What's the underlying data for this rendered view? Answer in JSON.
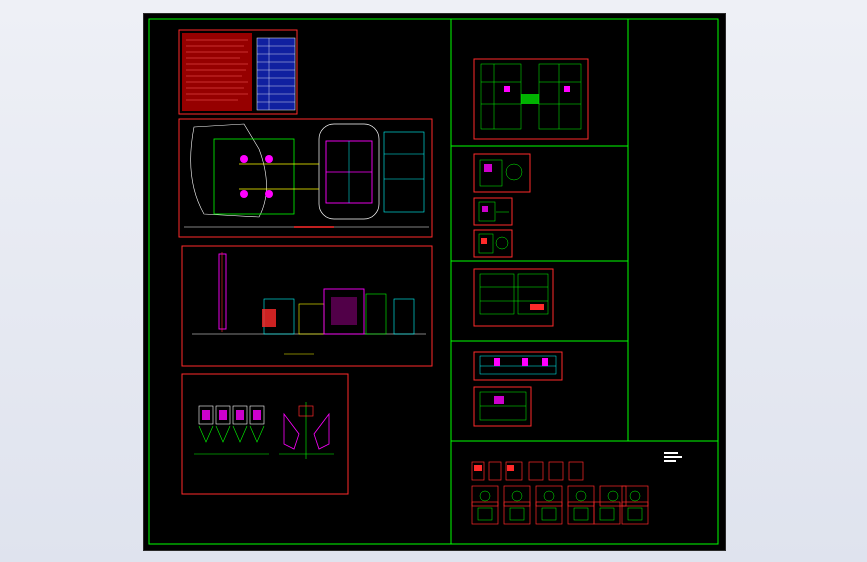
{
  "app": {
    "title": "",
    "viewport_background": "#000000",
    "outer_background": "#e6e9f1"
  },
  "colors": {
    "frame_green": "#00ff00",
    "sheet_border": "#ff2a2a",
    "cyan": "#00ffff",
    "magenta": "#ff00ff",
    "yellow": "#ffff00",
    "white": "#ffffff",
    "red_fill": "#d40000"
  },
  "drawing": {
    "sheets": [
      {
        "id": "notes-sheet",
        "kind": "notes-and-table"
      },
      {
        "id": "plan-sheet",
        "kind": "site-plan"
      },
      {
        "id": "elevation-sheet",
        "kind": "elevation"
      },
      {
        "id": "section-sheet",
        "kind": "section-details"
      },
      {
        "id": "right-sheet-1",
        "kind": "plan"
      },
      {
        "id": "right-sheet-2a",
        "kind": "detail"
      },
      {
        "id": "right-sheet-2b",
        "kind": "detail"
      },
      {
        "id": "right-sheet-2c",
        "kind": "detail"
      },
      {
        "id": "right-sheet-3",
        "kind": "plan"
      },
      {
        "id": "right-sheet-4a",
        "kind": "elevation"
      },
      {
        "id": "right-sheet-4b",
        "kind": "elevation"
      },
      {
        "id": "parts-grid",
        "kind": "component-thumbnails",
        "rows": 3,
        "columns": 6
      }
    ]
  }
}
